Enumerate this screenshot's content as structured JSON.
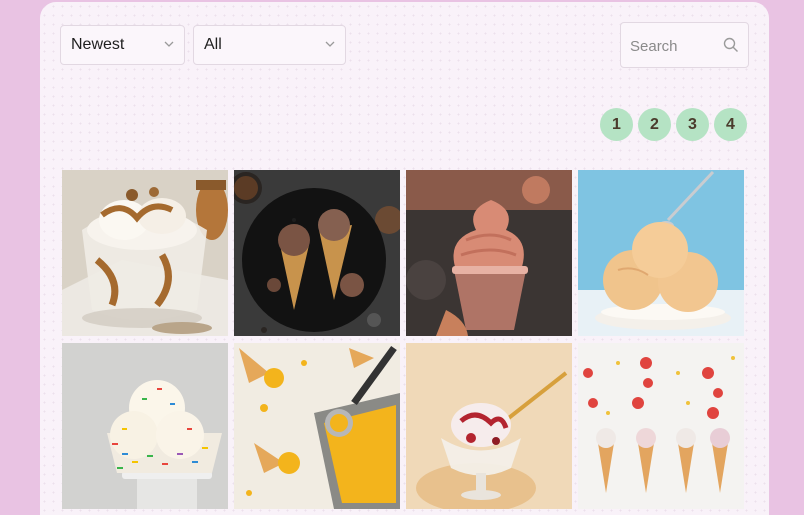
{
  "toolbar": {
    "sort": {
      "selected": "Newest"
    },
    "filter": {
      "selected": "All"
    },
    "search": {
      "placeholder": "Search",
      "value": ""
    }
  },
  "pagination": {
    "pages": [
      "1",
      "2",
      "3",
      "4"
    ]
  },
  "gallery": {
    "photos": [
      {
        "subject": "vanilla sundae with caramel and nuts in glass cup"
      },
      {
        "subject": "chocolate ice cream cones on dark plate"
      },
      {
        "subject": "strawberry soft serve in plastic cup"
      },
      {
        "subject": "peach ice cream scoops in bowl with spoon"
      },
      {
        "subject": "vanilla scoops with rainbow sprinkles on cake stand"
      },
      {
        "subject": "mango sorbet tray with scoop and cones"
      },
      {
        "subject": "ice cream with berry swirl in glass coupe"
      },
      {
        "subject": "berry ice cream cones in a row"
      }
    ]
  }
}
